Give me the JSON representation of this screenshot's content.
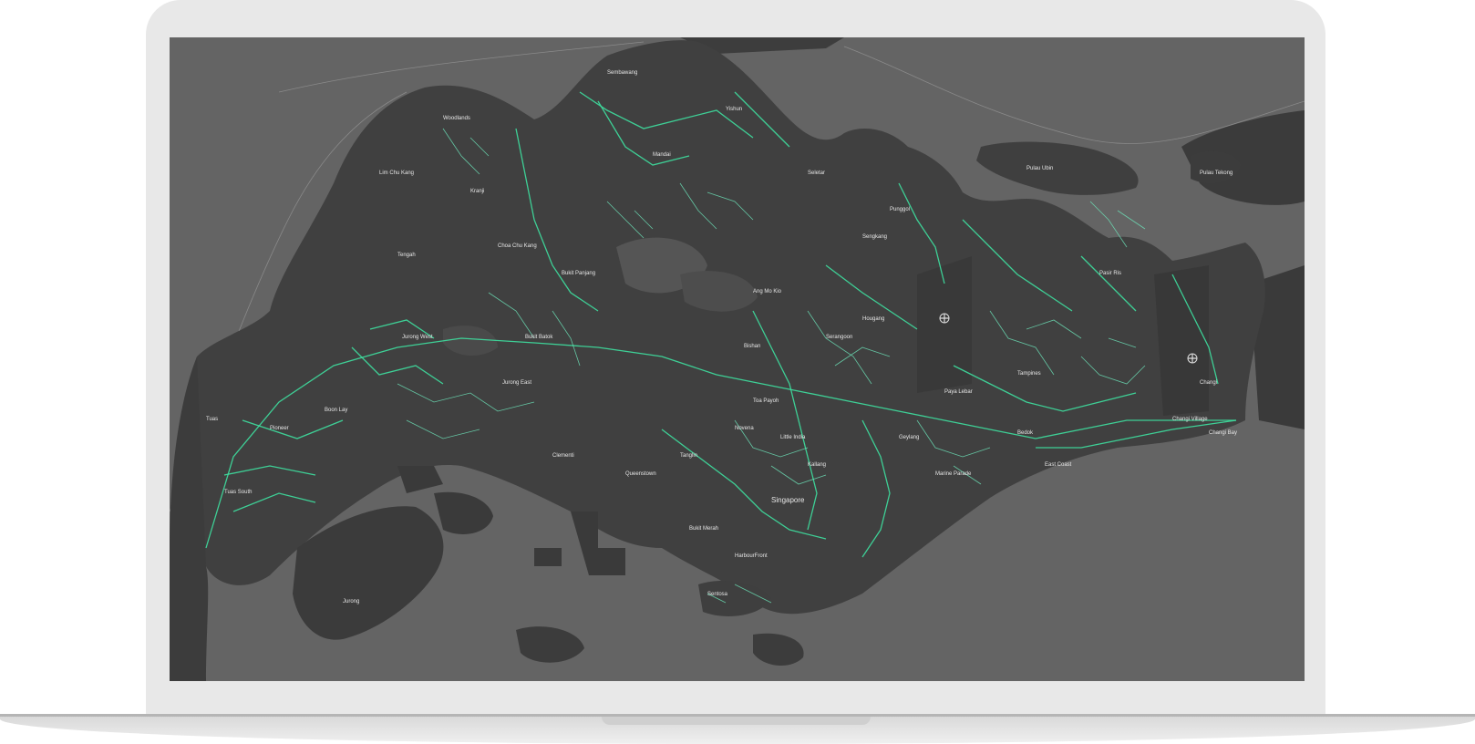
{
  "map": {
    "colors": {
      "water": "#646464",
      "land": "#404040",
      "land_dark": "#363636",
      "reservoir": "#555555",
      "roads": "#3ee0a0"
    },
    "icons": [
      "airport-icon",
      "airport-icon"
    ],
    "labels": {
      "jurong_west": "Jurong West",
      "jurong_east": "Jurong East",
      "boon_lay": "Boon Lay",
      "tuas_south": "Tuas South",
      "jurong": "Jurong",
      "singapore": "Singapore",
      "little_india": "Little India",
      "bukit_merah": "Bukit Merah",
      "bedok": "Bedok",
      "tampines": "Tampines",
      "changi_village": "Changi Village",
      "pasir_ris": "Pasir Ris",
      "kallang": "Kallang",
      "toa_payoh": "Toa Payoh",
      "sentosa": "Sentosa",
      "yishun": "Yishun",
      "woodlands": "Woodlands",
      "sembawang": "Sembawang",
      "punggol": "Punggol",
      "sengkang": "Sengkang",
      "hougang": "Hougang",
      "serangoon": "Serangoon",
      "ang_mo_kio": "Ang Mo Kio",
      "bishan": "Bishan",
      "clementi": "Clementi",
      "bukit_batok": "Bukit Batok",
      "choa_chu_kang": "Choa Chu Kang",
      "bukit_panjang": "Bukit Panjang",
      "mandai": "Mandai",
      "lim_chu_kang": "Lim Chu Kang",
      "tengah": "Tengah",
      "east_coast": "East Coast",
      "geylang": "Geylang",
      "marine_parade": "Marine Parade",
      "queenstown": "Queenstown",
      "tanglin": "Tanglin",
      "novena": "Novena",
      "paya_lebar": "Paya Lebar",
      "changi": "Changi",
      "pulau_ubin": "Pulau Ubin",
      "seletar": "Seletar",
      "kranji": "Kranji",
      "tuas": "Tuas",
      "pioneer": "Pioneer",
      "pulau_tekong": "Pulau Tekong",
      "harbourfront": "HarbourFront",
      "changi_bay": "Changi Bay"
    }
  }
}
